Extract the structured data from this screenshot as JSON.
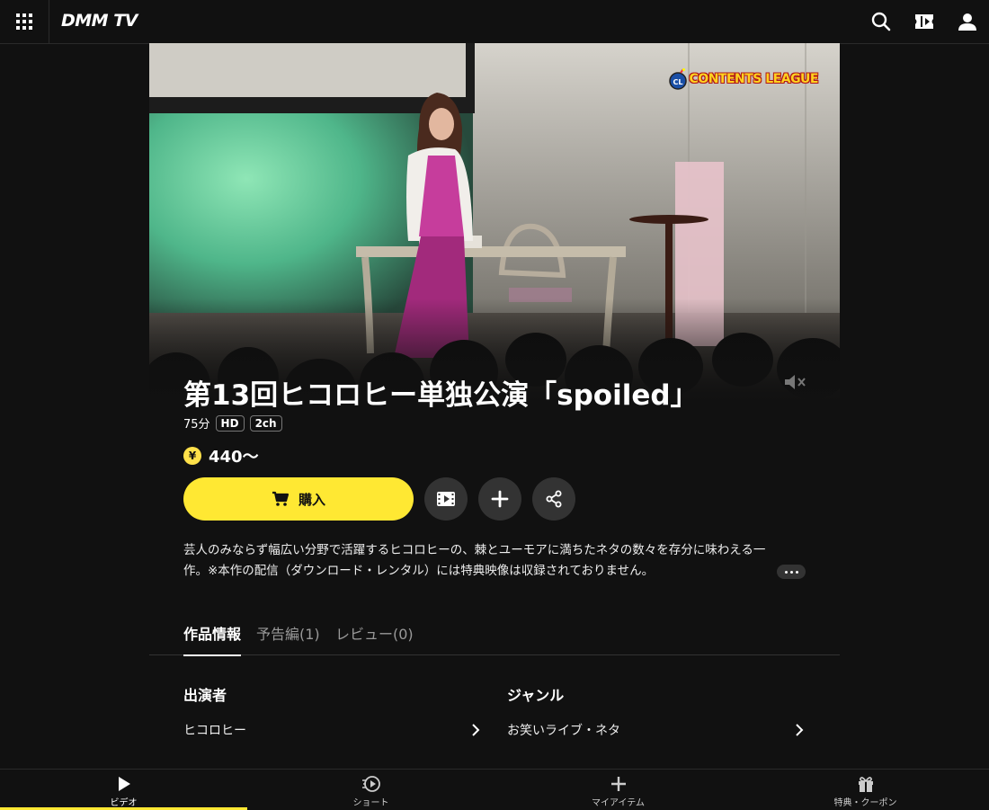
{
  "header": {
    "logo": "DMM TV"
  },
  "hero": {
    "badge_logo_text": "CONTENTS LEAGUE"
  },
  "title": "第13回ヒコロヒー単独公演「spoiled」",
  "meta": {
    "duration": "75分",
    "badges": [
      "HD",
      "2ch"
    ]
  },
  "price": {
    "symbol": "¥",
    "value": "440〜"
  },
  "actions": {
    "buy_label": "購入"
  },
  "description": {
    "line1": "芸人のみならず幅広い分野で活躍するヒコロヒーの、棘とユーモアに満ちたネタの数々を存分に味わえる一",
    "line2": "作。※本作の配信（ダウンロード・レンタル）には特典映像は収録されておりません。"
  },
  "tabs": [
    {
      "label": "作品情報"
    },
    {
      "label": "予告編(1)"
    },
    {
      "label": "レビュー(0)"
    }
  ],
  "info": {
    "cast_title": "出演者",
    "cast_item": "ヒコロヒー",
    "genre_title": "ジャンル",
    "genre_item": "お笑いライブ・ネタ"
  },
  "bottom_nav": [
    {
      "label": "ビデオ",
      "icon": "play-icon"
    },
    {
      "label": "ショート",
      "icon": "short-icon"
    },
    {
      "label": "マイアイテム",
      "icon": "plus-icon"
    },
    {
      "label": "特典・クーポン",
      "icon": "gift-icon"
    }
  ],
  "colors": {
    "accent": "#ffe833",
    "background": "#111111"
  }
}
